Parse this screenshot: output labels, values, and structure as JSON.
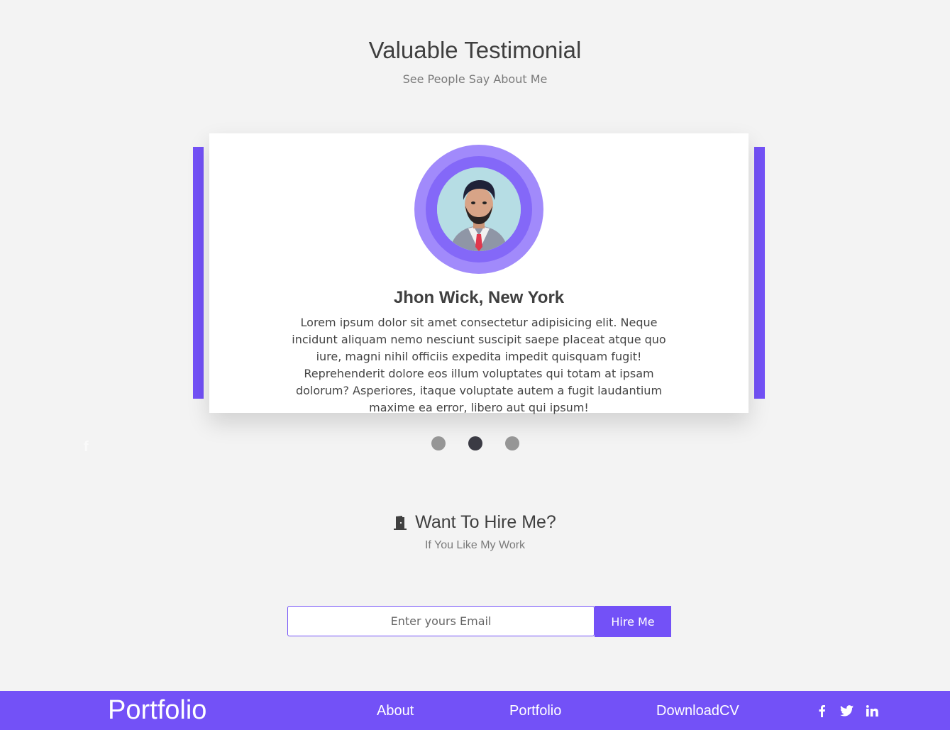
{
  "testimonials": {
    "title": "Valuable Testimonial",
    "subtitle": "See People Say About Me",
    "card": {
      "name": "Jhon Wick, New York",
      "text": "Lorem ipsum dolor sit amet consectetur adipisicing elit. Neque incidunt aliquam nemo nesciunt suscipit saepe placeat atque quo iure, magni nihil officiis expedita impedit quisquam fugit! Reprehenderit dolore eos illum voluptates qui totam at ipsam dolorum? Asperiores, itaque voluptate autem a fugit laudantium maxime ea error, libero aut qui ipsum!"
    },
    "dots": [
      "slide-1",
      "slide-2",
      "slide-3"
    ],
    "active_dot": 2
  },
  "faint_icon": "f",
  "hire": {
    "title": "Want To Hire Me?",
    "subtitle": "If You Like My Work",
    "email_placeholder": "Enter yours Email",
    "button_label": "Hire Me",
    "icon": "door-icon"
  },
  "footer": {
    "brand": "Portfolio",
    "links": {
      "about": "About",
      "portfolio": "Portfolio",
      "download": "DownloadCV"
    },
    "social_icons": [
      "facebook-icon",
      "twitter-icon",
      "linkedin-icon"
    ]
  },
  "colors": {
    "accent": "#7351f7",
    "background": "#f3f3f3",
    "avatar_ring_outer": "#a18afb",
    "avatar_ring_inner": "#8468f8"
  }
}
